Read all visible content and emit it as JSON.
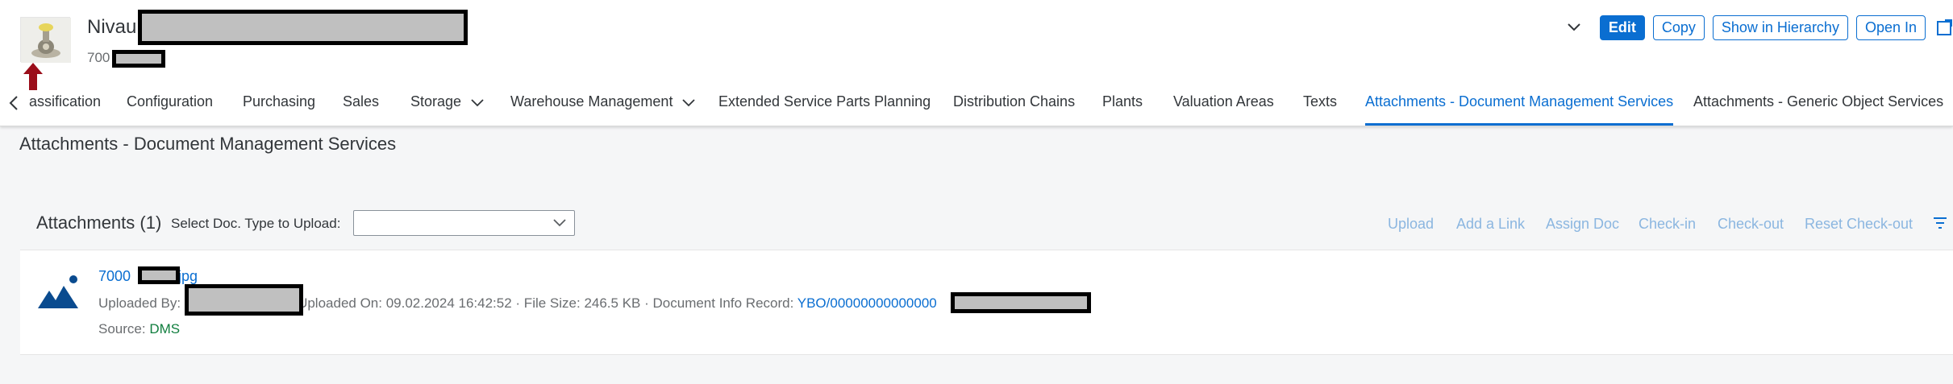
{
  "header": {
    "title_prefix": "Nivau",
    "subtitle_prefix": "700",
    "thumbnail_icon": "product-thumbnail-icon",
    "annotation_icon": "red-up-arrow-icon"
  },
  "actions": {
    "expand_icon": "chevron-down-icon",
    "edit": "Edit",
    "copy": "Copy",
    "show_in_hierarchy": "Show in Hierarchy",
    "open_in": "Open In",
    "external_icon": "external-link-icon"
  },
  "tabs": [
    {
      "label": "assification"
    },
    {
      "label": "Configuration"
    },
    {
      "label": "Purchasing"
    },
    {
      "label": "Sales"
    },
    {
      "label": "Storage"
    },
    {
      "label": "Warehouse Management"
    },
    {
      "label": "Extended Service Parts Planning"
    },
    {
      "label": "Distribution Chains"
    },
    {
      "label": "Plants"
    },
    {
      "label": "Valuation Areas"
    },
    {
      "label": "Texts"
    },
    {
      "label": "Attachments - Document Management Services"
    },
    {
      "label": "Attachments - Generic Object Services"
    }
  ],
  "section": {
    "title": "Attachments - Document Management Services"
  },
  "attachments": {
    "count_label": "Attachments (1)",
    "select_label": "Select Doc. Type to Upload:",
    "select_value": "",
    "toolbar": {
      "upload": "Upload",
      "add_link": "Add a Link",
      "assign_doc": "Assign Doc",
      "check_in": "Check-in",
      "check_out": "Check-out",
      "reset_check_out": "Reset Check-out"
    },
    "item": {
      "icon": "image-file-icon",
      "name_prefix": "7000",
      "name_suffix": ".jpg",
      "uploaded_by_label": "Uploaded By:",
      "uploaded_on": "Uploaded On: 09.02.2024 16:42:52",
      "file_size": "· File Size: 246.5 KB",
      "doc_info_label": "· Document Info Record:",
      "doc_info_value": "YBO/00000000000000",
      "source_label": "Source:",
      "source_value": "DMS"
    }
  },
  "colors": {
    "accent": "#0a6ed1",
    "disabled_action": "#8bb6e0",
    "source_green": "#107e3e",
    "annotation_red": "#9b0e1a"
  }
}
